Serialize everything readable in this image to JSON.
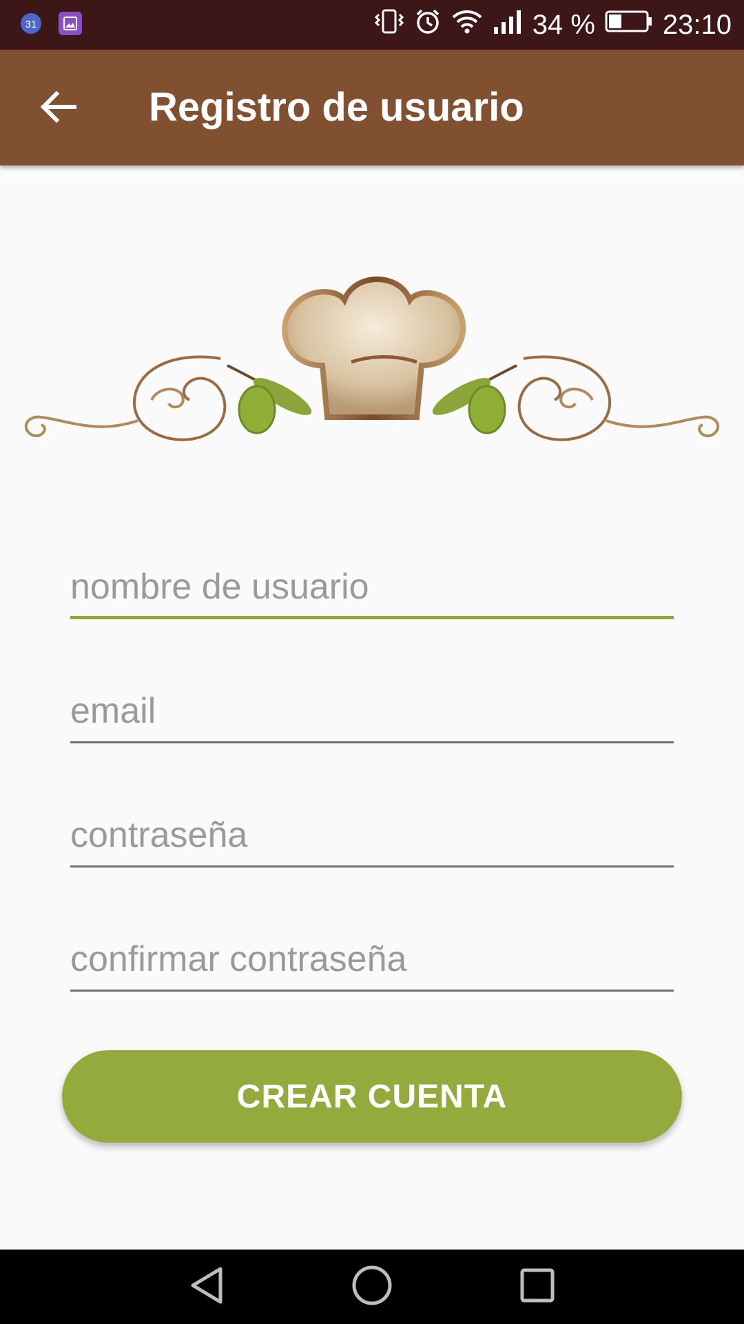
{
  "status_bar": {
    "time": "23:10",
    "battery": "34 %",
    "icons": [
      "calendar-icon",
      "gallery-icon",
      "vibrate-icon",
      "alarm-icon",
      "wifi-icon",
      "signal-icon",
      "battery-icon"
    ],
    "calendar_day": "31"
  },
  "app_bar": {
    "title": "Registro de usuario",
    "back_icon": "arrow-back-icon",
    "color": "#805030"
  },
  "form": {
    "username_placeholder": "nombre de usuario",
    "email_placeholder": "email",
    "password_placeholder": "contraseña",
    "confirm_password_placeholder": "confirmar contraseña",
    "username_value": "",
    "email_value": "",
    "password_value": "",
    "confirm_password_value": "",
    "active_field": "username",
    "accent_color": "#93a63b"
  },
  "actions": {
    "create_account_label": "CREAR CUENTA",
    "button_color": "#95aa3c"
  },
  "nav_bar": {
    "icons": [
      "back-triangle-icon",
      "home-circle-icon",
      "recents-square-icon"
    ]
  }
}
